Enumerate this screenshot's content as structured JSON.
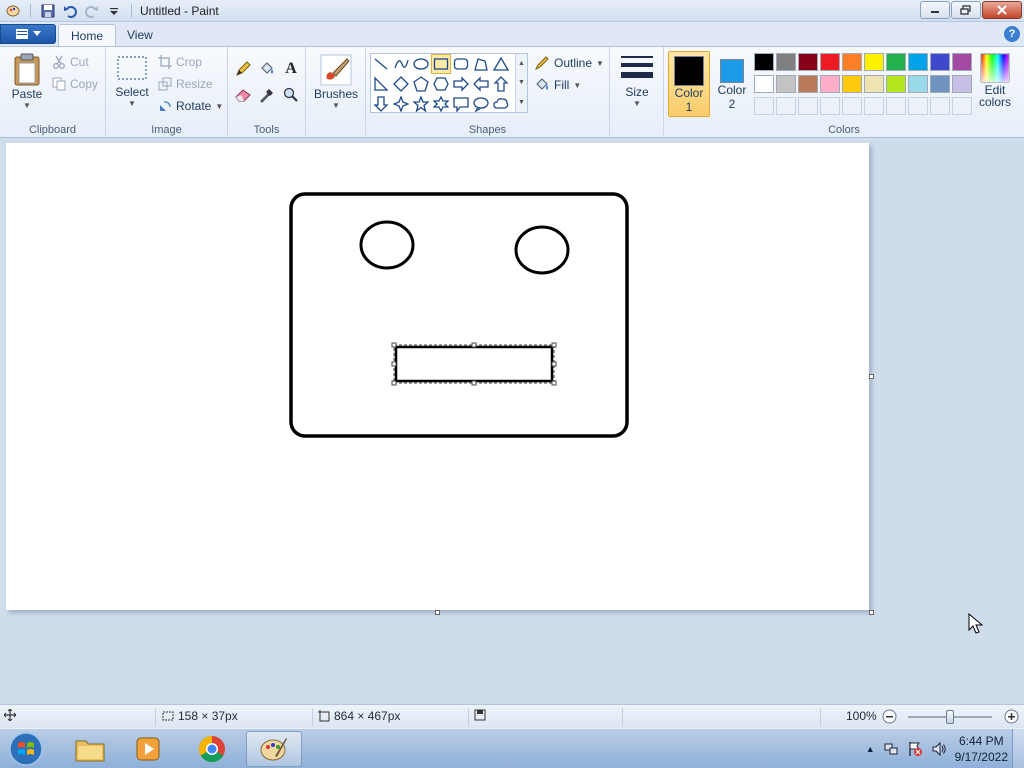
{
  "window": {
    "title": "Untitled - Paint"
  },
  "tabs": [
    {
      "label": "Home"
    },
    {
      "label": "View"
    }
  ],
  "clipboard": {
    "paste": "Paste",
    "cut": "Cut",
    "copy": "Copy",
    "label": "Clipboard"
  },
  "image": {
    "select": "Select",
    "crop": "Crop",
    "resize": "Resize",
    "rotate": "Rotate",
    "label": "Image"
  },
  "tools": {
    "label": "Tools"
  },
  "brushes": {
    "label": "Brushes"
  },
  "shapes": {
    "outline": "Outline",
    "fill": "Fill",
    "label": "Shapes"
  },
  "size": {
    "label": "Size"
  },
  "colors": {
    "color1": "Color",
    "color1_num": "1",
    "color2": "Color",
    "color2_num": "2",
    "edit_line1": "Edit",
    "edit_line2": "colors",
    "label": "Colors",
    "color1_value": "#000000",
    "color2_value": "#1e9be6",
    "palette_row1": [
      "#000000",
      "#7f7f7f",
      "#880015",
      "#ed1c24",
      "#ff7f27",
      "#fff200",
      "#22b14c",
      "#00a2e8",
      "#3f48cc",
      "#a349a4"
    ],
    "palette_row2": [
      "#ffffff",
      "#c3c3c3",
      "#b97a57",
      "#ffaec9",
      "#ffc90e",
      "#efe4b0",
      "#b5e61d",
      "#99d9ea",
      "#7092be",
      "#c8bfe7"
    ]
  },
  "status": {
    "selection_size": "158 × 37px",
    "canvas_size": "864 × 467px",
    "zoom": "100%"
  },
  "taskbar": {
    "time": "6:44 PM",
    "date": "9/17/2022"
  }
}
